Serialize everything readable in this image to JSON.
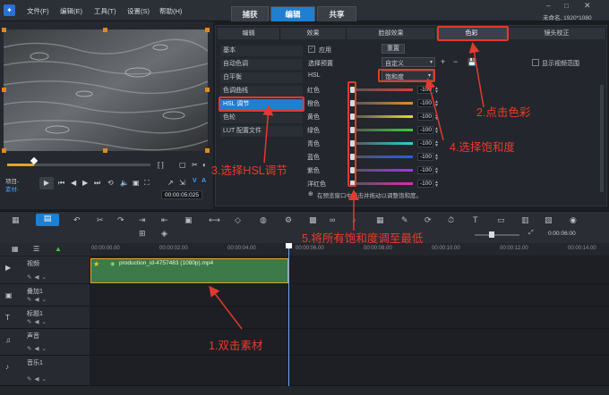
{
  "menu": {
    "items": [
      "文件(F)",
      "编辑(E)",
      "工具(T)",
      "设置(S)",
      "帮助(H)"
    ]
  },
  "main_tabs": {
    "capture": "捕获",
    "edit": "编辑",
    "share": "共享"
  },
  "project": {
    "info": "未命名, 1920*1080"
  },
  "player": {
    "project_label": "项目-",
    "clip_label": "素材-",
    "timecode": "00:00:05:025"
  },
  "edit_tabs": [
    "编辑",
    "效果",
    "脸部效果",
    "色彩",
    "镜头校正"
  ],
  "categories": [
    "基本",
    "自动色调",
    "白平衡",
    "色调曲线",
    "HSL 调节",
    "色轮",
    "LUT 配置文件"
  ],
  "controls": {
    "apply_label": "应用",
    "reset_label": "重置",
    "preset_label": "选择预置",
    "preset_value": "自定义",
    "hsl_label": "HSL",
    "hsl_mode": "饱和度",
    "show_range_label": "显示视频范围",
    "hint": "在预览窗口中单击并拖动以调整饱和度。"
  },
  "hsl_rows": [
    {
      "name": "红色",
      "value": "-100",
      "color": "#e03a3a"
    },
    {
      "name": "橙色",
      "value": "-100",
      "color": "#e8892a"
    },
    {
      "name": "黄色",
      "value": "-100",
      "color": "#e8d82a"
    },
    {
      "name": "绿色",
      "value": "-100",
      "color": "#3ccc3c"
    },
    {
      "name": "青色",
      "value": "-100",
      "color": "#2ad0d8"
    },
    {
      "name": "蓝色",
      "value": "-100",
      "color": "#2a5ae8"
    },
    {
      "name": "紫色",
      "value": "-100",
      "color": "#9a3ae8"
    },
    {
      "name": "洋红色",
      "value": "-100",
      "color": "#e02ab8"
    }
  ],
  "timeline": {
    "ruler": [
      "00:00:00.00",
      "00:00:02.00",
      "00:00:04.00",
      "00:00:06.00",
      "00:00:08.00",
      "00:00:10.00",
      "00:00:12.00",
      "00:00:14.00"
    ],
    "zoom_time": "0:00:06:00",
    "tracks": [
      "视频",
      "叠加1",
      "标题1",
      "声音",
      "音乐1"
    ],
    "clip_name": "production_id-4757483 (1080p).mp4"
  },
  "annotations": {
    "step1": "1.双击素材",
    "step2": "2.点击色彩",
    "step3": "3.选择HSL调节",
    "step4": "4.选择饱和度",
    "step5": "5.将所有饱和度调至最低"
  },
  "colors": {
    "accent": "#1f7fd0",
    "annotation": "#e23a2c",
    "clip": "#3d7a4a"
  }
}
